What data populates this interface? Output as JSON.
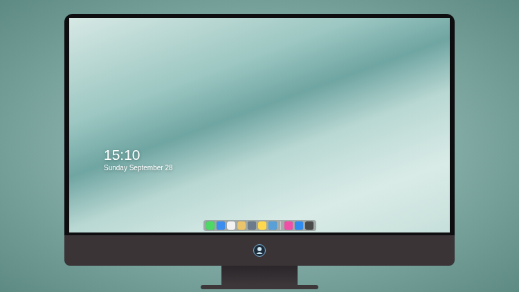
{
  "lock_screen": {
    "time": "15:10",
    "date": "Sunday September 28"
  },
  "dock": {
    "items": [
      {
        "kind": "app",
        "color": "#4cd964"
      },
      {
        "kind": "app",
        "color": "#3b8ef0"
      },
      {
        "kind": "app",
        "color": "#f2f2f2"
      },
      {
        "kind": "app",
        "color": "#e9c46a"
      },
      {
        "kind": "app",
        "color": "#6b7b8c"
      },
      {
        "kind": "app",
        "color": "#ffd84d"
      },
      {
        "kind": "app",
        "color": "#5aa0d8"
      },
      {
        "kind": "separator",
        "color": "#d0d0d0"
      },
      {
        "kind": "app",
        "color": "#f04fa8"
      },
      {
        "kind": "app",
        "color": "#2f8cf0"
      },
      {
        "kind": "app",
        "color": "#4a4a4a"
      }
    ]
  }
}
